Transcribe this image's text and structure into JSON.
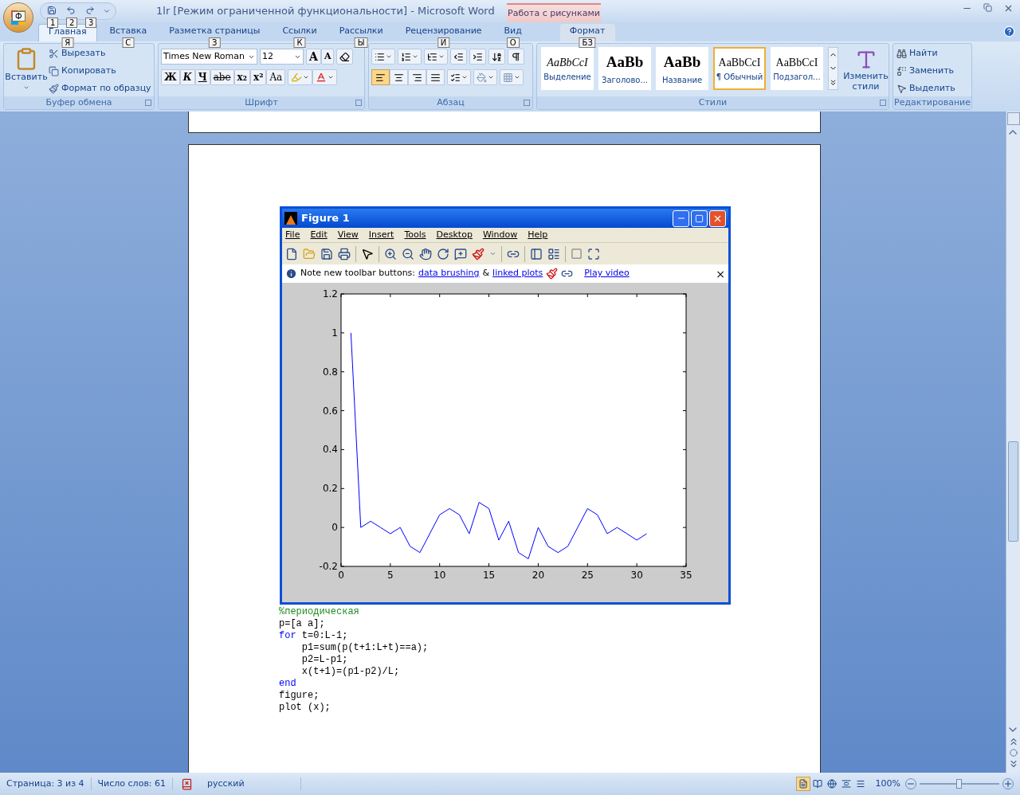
{
  "window": {
    "title": "1lr [Режим ограниченной функциональности] - Microsoft Word",
    "contextual_group": "Работа с рисунками"
  },
  "office_button": {
    "keytip": "Ф"
  },
  "quick_access": [
    {
      "kind": "save",
      "keytip": "1"
    },
    {
      "kind": "undo",
      "keytip": "2"
    },
    {
      "kind": "redo",
      "keytip": "3"
    }
  ],
  "tabs": [
    {
      "label": "Главная",
      "keytip": "Я",
      "selected": true,
      "contextual": false
    },
    {
      "label": "Вставка",
      "keytip": "С",
      "selected": false,
      "contextual": false
    },
    {
      "label": "Разметка страницы",
      "keytip": "З",
      "selected": false,
      "contextual": false
    },
    {
      "label": "Ссылки",
      "keytip": "К",
      "selected": false,
      "contextual": false
    },
    {
      "label": "Рассылки",
      "keytip": "Ы",
      "selected": false,
      "contextual": false
    },
    {
      "label": "Рецензирование",
      "keytip": "И",
      "selected": false,
      "contextual": false
    },
    {
      "label": "Вид",
      "keytip": "О",
      "selected": false,
      "contextual": false
    },
    {
      "label": "Формат",
      "keytip": "БЗ",
      "selected": false,
      "contextual": true
    }
  ],
  "clipboard": {
    "title": "Буфер обмена",
    "paste": "Вставить",
    "items": [
      {
        "kind": "cut",
        "label": "Вырезать"
      },
      {
        "kind": "copy",
        "label": "Копировать"
      },
      {
        "kind": "painter",
        "label": "Формат по образцу"
      }
    ]
  },
  "font": {
    "title": "Шрифт",
    "name": "Times New Roman",
    "size": "12",
    "size_buttons": [
      {
        "kind": "grow",
        "label": "A"
      },
      {
        "kind": "shrink",
        "label": "A"
      }
    ],
    "format_buttons": [
      {
        "kind": "bold",
        "label": "Ж"
      },
      {
        "kind": "italic",
        "label": "К"
      },
      {
        "kind": "underline",
        "label": "Ч"
      },
      {
        "kind": "strike",
        "label": "abe"
      },
      {
        "kind": "sub",
        "label": "x₂"
      },
      {
        "kind": "sup",
        "label": "x²"
      },
      {
        "kind": "case",
        "label": "Aa"
      }
    ]
  },
  "paragraph": {
    "title": "Абзац",
    "alignment": [
      {
        "kind": "left",
        "selected": true
      },
      {
        "kind": "center",
        "selected": false
      },
      {
        "kind": "right",
        "selected": false
      },
      {
        "kind": "justify",
        "selected": false
      }
    ]
  },
  "styles": {
    "title": "Стили",
    "change": "Изменить стили",
    "items": [
      {
        "kind": "italic",
        "sample": "AaBbCcI",
        "label": "Выделение",
        "selected": false
      },
      {
        "kind": "heading",
        "sample": "AaBb",
        "label": "Заголово...",
        "selected": false
      },
      {
        "kind": "heading",
        "sample": "AaBb",
        "label": "Название",
        "selected": false
      },
      {
        "kind": "normal",
        "sample": "AaBbCcI",
        "label": "¶ Обычный",
        "selected": true
      },
      {
        "kind": "normal",
        "sample": "AaBbCcI",
        "label": "Подзагол...",
        "selected": false
      }
    ]
  },
  "editing": {
    "title": "Редактирование",
    "items": [
      {
        "kind": "find",
        "label": "Найти"
      },
      {
        "kind": "replace",
        "label": "Заменить"
      },
      {
        "kind": "select",
        "label": "Выделить"
      }
    ]
  },
  "figure": {
    "title": "Figure 1",
    "menu": [
      "File",
      "Edit",
      "View",
      "Insert",
      "Tools",
      "Desktop",
      "Window",
      "Help"
    ],
    "note": {
      "text": "Note new toolbar buttons:",
      "link1": "data brushing",
      "amp": "&",
      "link2": "linked plots",
      "video": "Play video",
      "close": "×"
    },
    "chart_data": {
      "type": "line",
      "x": [
        1,
        2,
        3,
        4,
        5,
        6,
        7,
        8,
        9,
        10,
        11,
        12,
        13,
        14,
        15,
        16,
        17,
        18,
        19,
        20,
        21,
        22,
        23,
        24,
        25,
        26,
        27,
        28,
        29,
        30,
        31
      ],
      "series": [
        {
          "color": "#0000ff",
          "values": [
            1,
            0,
            0.032,
            0,
            -0.032,
            0,
            -0.097,
            -0.129,
            -0.032,
            0.065,
            0.097,
            0.065,
            -0.032,
            0.129,
            0.097,
            -0.065,
            0.032,
            -0.129,
            -0.161,
            0,
            -0.097,
            -0.129,
            -0.097,
            0,
            0.097,
            0.065,
            -0.032,
            0,
            -0.032,
            -0.065,
            -0.032
          ]
        }
      ],
      "xlim": [
        0,
        35
      ],
      "ylim": [
        -0.2,
        1.2
      ],
      "xticks": [
        0,
        5,
        10,
        15,
        20,
        25,
        30,
        35
      ],
      "yticks": [
        {
          "value": -0.2,
          "label": "-0.2"
        },
        {
          "value": 0,
          "label": "0"
        },
        {
          "value": 0.2,
          "label": "0.2"
        },
        {
          "value": 0.4,
          "label": "0.4"
        },
        {
          "value": 0.6,
          "label": "0.6"
        },
        {
          "value": 0.8,
          "label": "0.8"
        },
        {
          "value": 1,
          "label": "1"
        },
        {
          "value": 1.2,
          "label": "1.2"
        }
      ]
    }
  },
  "code": [
    [
      {
        "kind": "comment",
        "text": "%периодическая"
      }
    ],
    [
      {
        "kind": "plain",
        "text": "p=[a a];"
      }
    ],
    [
      {
        "kind": "keyword",
        "text": "for"
      },
      {
        "kind": "plain",
        "text": " t=0:L-1;"
      }
    ],
    [
      {
        "kind": "plain",
        "text": "    p1=sum(p(t+1:L+t)==a);"
      }
    ],
    [
      {
        "kind": "plain",
        "text": "    p2=L-p1;"
      }
    ],
    [
      {
        "kind": "plain",
        "text": "    x(t+1)=(p1-p2)/L;"
      }
    ],
    [
      {
        "kind": "keyword",
        "text": "end"
      }
    ],
    [
      {
        "kind": "plain",
        "text": "figure;"
      }
    ],
    [
      {
        "kind": "plain",
        "text": "plot (x);"
      }
    ]
  ],
  "status": {
    "page": "Страница: 3 из 4",
    "words": "Число слов: 61",
    "language": "русский",
    "zoom": "100%",
    "zoom_slider": {
      "level": 0.5
    },
    "views": [
      {
        "kind": "print",
        "selected": true
      },
      {
        "kind": "read",
        "selected": false
      },
      {
        "kind": "web",
        "selected": false
      },
      {
        "kind": "outline",
        "selected": false
      },
      {
        "kind": "draft",
        "selected": false
      }
    ]
  }
}
